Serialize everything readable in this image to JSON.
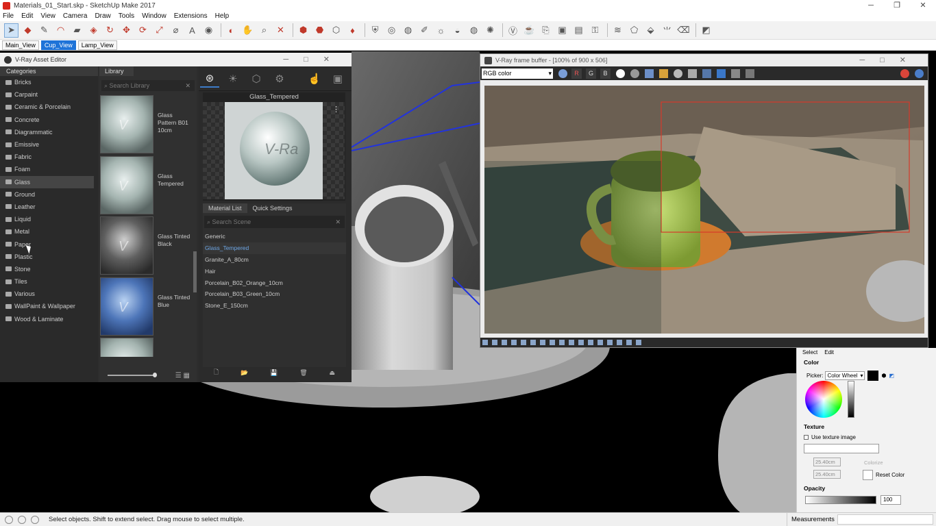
{
  "window": {
    "title": "Materials_01_Start.skp - SketchUp Make 2017",
    "minimize": "─",
    "restore": "❐",
    "close": "✕"
  },
  "menu": [
    "File",
    "Edit",
    "View",
    "Camera",
    "Draw",
    "Tools",
    "Window",
    "Extensions",
    "Help"
  ],
  "scene_tabs": [
    {
      "label": "Main_View",
      "active": false
    },
    {
      "label": "Cup_View",
      "active": true
    },
    {
      "label": "Lamp_View",
      "active": false
    }
  ],
  "asset_editor": {
    "title": "V-Ray Asset Editor",
    "categories_header": "Categories",
    "categories": [
      "Bricks",
      "Carpaint",
      "Ceramic & Porcelain",
      "Concrete",
      "Diagrammatic",
      "Emissive",
      "Fabric",
      "Foam",
      "Glass",
      "Ground",
      "Leather",
      "Liquid",
      "Metal",
      "Paper",
      "Plastic",
      "Stone",
      "Tiles",
      "Various",
      "WallPaint & Wallpaper",
      "Wood & Laminate"
    ],
    "selected_category": "Glass",
    "library_header": "Library",
    "library_search_placeholder": "Search Library",
    "library_items": [
      {
        "name": "Glass Pattern B01 10cm",
        "tint": "clear"
      },
      {
        "name": "Glass Tempered",
        "tint": "clear"
      },
      {
        "name": "Glass Tinted Black",
        "tint": "black"
      },
      {
        "name": "Glass Tinted Blue",
        "tint": "blue"
      }
    ],
    "preview_name": "Glass_Tempered",
    "preview_watermark": "V-Ra",
    "material_tabs": [
      "Material List",
      "Quick Settings"
    ],
    "scene_search_placeholder": "Search Scene",
    "materials": [
      "Generic",
      "Glass_Tempered",
      "Granite_A_80cm",
      "Hair",
      "Porcelain_B02_Orange_10cm",
      "Porcelain_B03_Green_10cm",
      "Stone_E_150cm"
    ],
    "selected_material": "Glass_Tempered"
  },
  "frame_buffer": {
    "title": "V-Ray frame buffer - [100% of 900 x 506]",
    "channel": "RGB color",
    "channels": [
      "R",
      "G",
      "B"
    ]
  },
  "materials_tray": {
    "tabs": [
      "Select",
      "Edit"
    ],
    "color_label": "Color",
    "picker_label": "Picker:",
    "picker_value": "Color Wheel",
    "texture_label": "Texture",
    "use_texture": "Use texture image",
    "width": "25.40cm",
    "height": "25.40cm",
    "colorize": "Colorize",
    "reset_color": "Reset Color",
    "opacity_label": "Opacity",
    "opacity_value": "100"
  },
  "status": {
    "text": "Select objects. Shift to extend select. Drag mouse to select multiple.",
    "measurements": "Measurements"
  },
  "colors": {
    "accent": "#1e73d8",
    "selected_material_text": "#6ea7e6",
    "panel_bg": "#2d2d2d"
  }
}
